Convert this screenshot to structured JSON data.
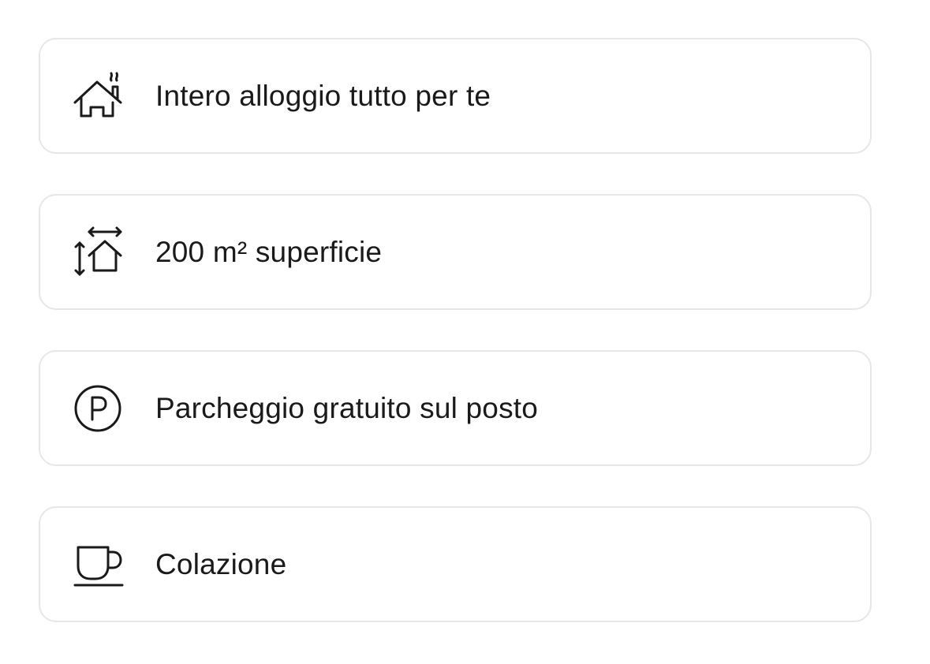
{
  "amenities": [
    {
      "label": "Intero alloggio tutto per te",
      "icon": "house-chimney-icon"
    },
    {
      "label": "200 m² superficie",
      "icon": "floor-area-icon"
    },
    {
      "label": "Parcheggio gratuito sul posto",
      "icon": "parking-icon"
    },
    {
      "label": "Colazione",
      "icon": "coffee-cup-icon"
    }
  ],
  "colors": {
    "text": "#1a1a1a",
    "border": "#e7e7e7",
    "background": "#ffffff"
  }
}
